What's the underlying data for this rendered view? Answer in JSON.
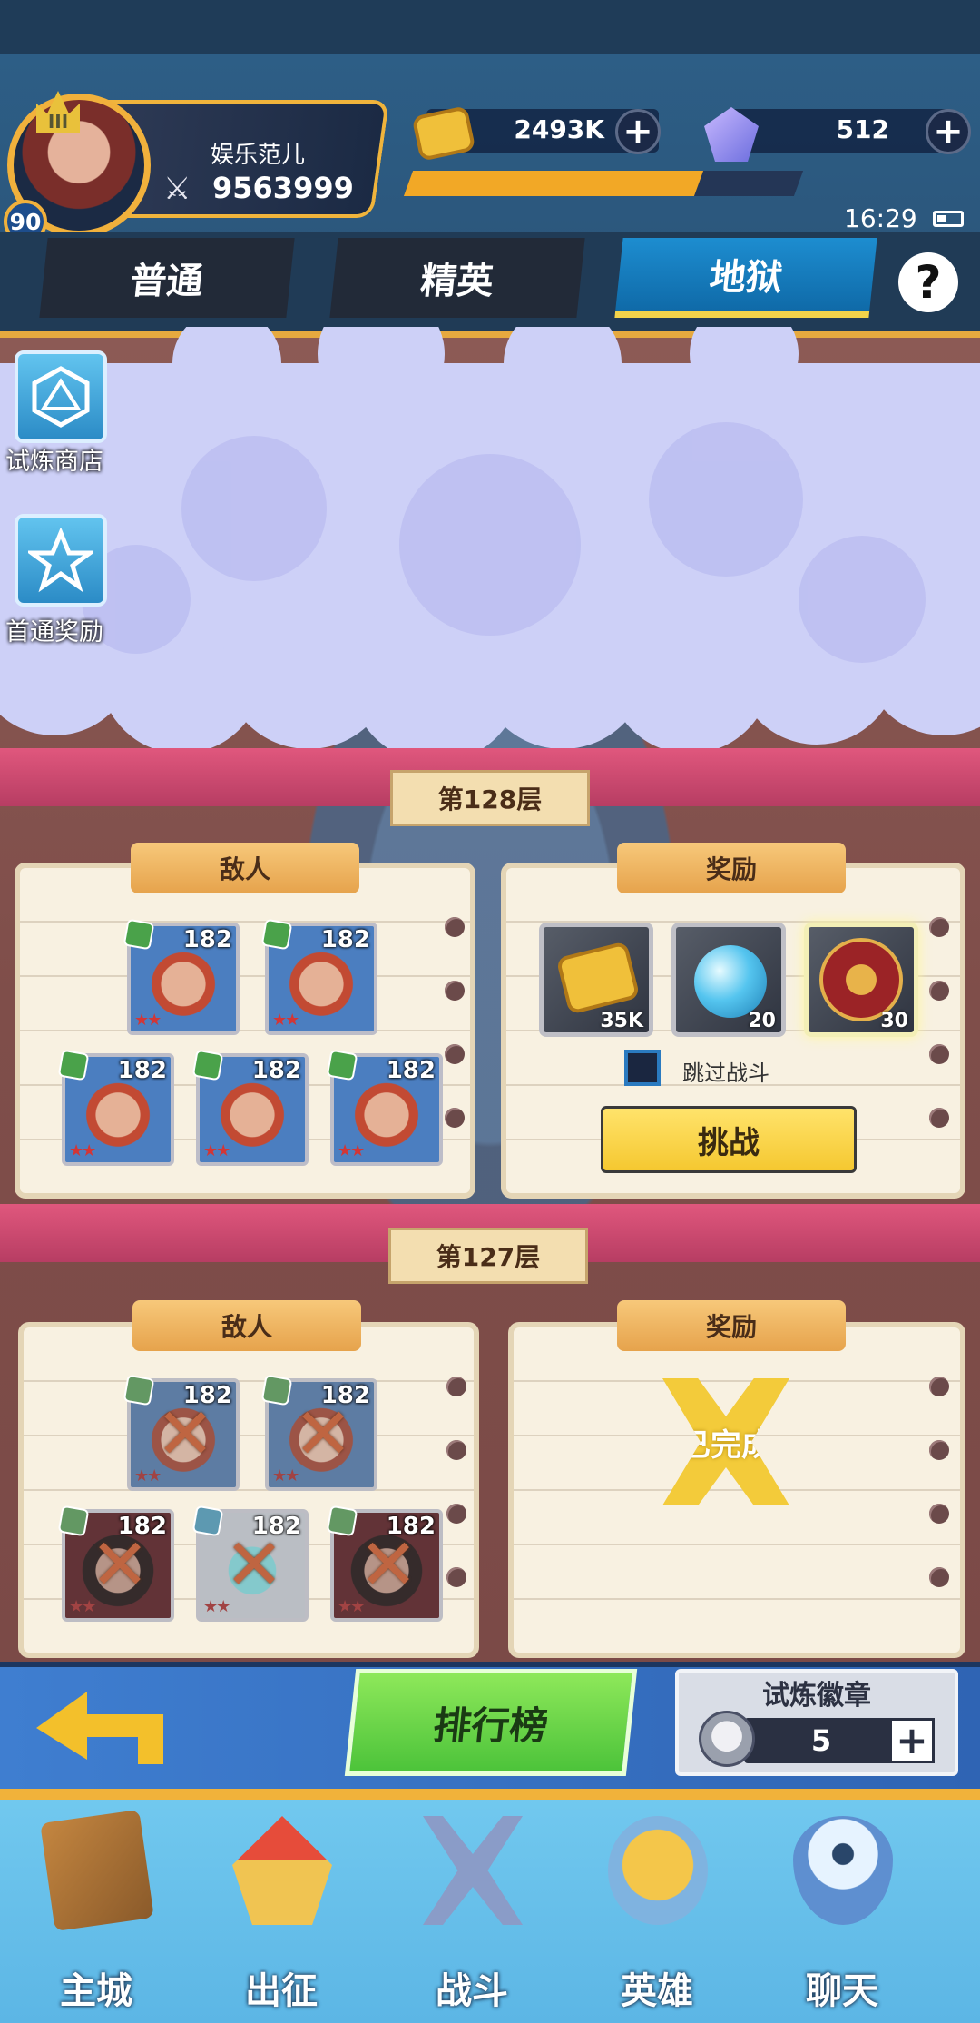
{
  "player": {
    "name": "娱乐范儿",
    "power": "9563999",
    "level": "90",
    "rank_badge": "III"
  },
  "resources": {
    "gold": "2493K",
    "gems": "512",
    "plus": "+"
  },
  "clock": "16:29",
  "tabs": [
    {
      "label": "普通"
    },
    {
      "label": "精英"
    },
    {
      "label": "地狱"
    }
  ],
  "active_tab": "地狱",
  "help_label": "?",
  "side_buttons": [
    {
      "label": "试炼商店",
      "icon": "d20-icon"
    },
    {
      "label": "首通奖励",
      "icon": "star-icon"
    }
  ],
  "floors": [
    {
      "label": "第128层",
      "enemy_tag": "敌人",
      "reward_tag": "奖励",
      "enemies": [
        {
          "level": "182",
          "stars": "★★",
          "defeated": false
        },
        {
          "level": "182",
          "stars": "★★",
          "defeated": false
        },
        {
          "level": "182",
          "stars": "★★",
          "defeated": false
        },
        {
          "level": "182",
          "stars": "★★",
          "defeated": false
        },
        {
          "level": "182",
          "stars": "★★",
          "defeated": false
        }
      ],
      "rewards": [
        {
          "icon": "gold-coin-icon",
          "count": "35K"
        },
        {
          "icon": "crystal-orb-icon",
          "count": "20"
        },
        {
          "icon": "emblem-icon",
          "count": "30"
        }
      ],
      "skip_label": "跳过战斗",
      "challenge_label": "挑战"
    },
    {
      "label": "第127层",
      "enemy_tag": "敌人",
      "reward_tag": "奖励",
      "enemies": [
        {
          "level": "182",
          "stars": "★★",
          "defeated": true
        },
        {
          "level": "182",
          "stars": "★★",
          "defeated": true
        },
        {
          "level": "182",
          "stars": "★★",
          "defeated": true
        },
        {
          "level": "182",
          "stars": "★★",
          "defeated": true
        },
        {
          "level": "182",
          "stars": "★★",
          "defeated": true
        }
      ],
      "completed_label": "已完成"
    }
  ],
  "defeat_mark": "✕",
  "action_bar": {
    "rankings_label": "排行榜",
    "badge_title": "试炼徽章",
    "badge_count": "5",
    "badge_plus": "+"
  },
  "nav": [
    {
      "label": "主城",
      "icon": "city-book-icon"
    },
    {
      "label": "出征",
      "icon": "ship-icon"
    },
    {
      "label": "战斗",
      "icon": "crossed-swords-icon"
    },
    {
      "label": "英雄",
      "icon": "hero-helmet-icon"
    },
    {
      "label": "聊天",
      "icon": "chat-bubble-icon"
    }
  ],
  "colors": {
    "accent_gold": "#f1b23a",
    "challenge_yellow": "#f5c830",
    "rankings_green": "#4cc33a",
    "floor_ribbon": "#e0577d",
    "tab_active": "#1d8dd0"
  }
}
